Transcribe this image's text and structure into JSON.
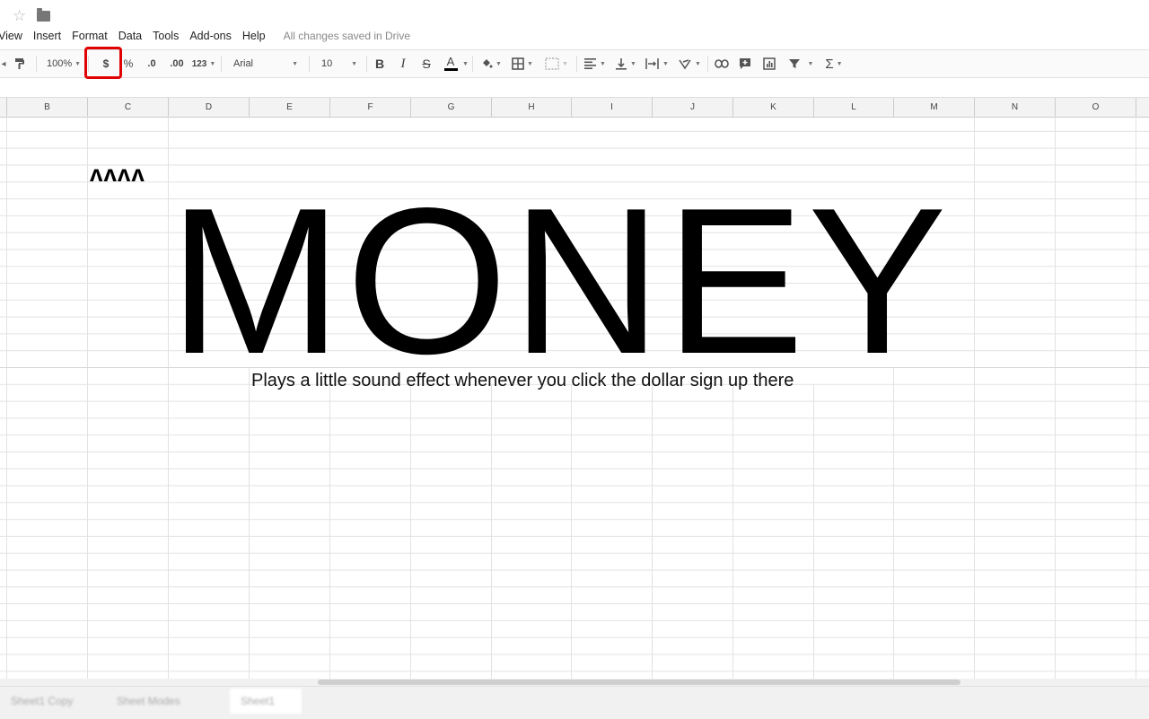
{
  "header": {
    "star_icon": "star-outline-icon",
    "folder_icon": "folder-icon"
  },
  "menu": {
    "items": [
      "View",
      "Insert",
      "Format",
      "Data",
      "Tools",
      "Add-ons",
      "Help"
    ],
    "save_status": "All changes saved in Drive"
  },
  "toolbar": {
    "zoom": "100%",
    "currency": "$",
    "percent": "%",
    "decrease_decimal": ".0",
    "increase_decimal": ".00",
    "more_formats": "123",
    "font": "Arial",
    "font_size": "10",
    "bold": "B",
    "italic": "I",
    "strikethrough": "S",
    "text_color": "A",
    "highlight_color": "#e00000"
  },
  "sheet": {
    "columns": [
      "B",
      "C",
      "D",
      "E",
      "F",
      "G",
      "H",
      "I",
      "J",
      "K",
      "L",
      "M",
      "N",
      "O"
    ],
    "c1_text": "ʌʌʌʌ",
    "d1_text": "MONEY",
    "e2_text": "Plays a little sound effect whenever you click the dollar sign up there"
  },
  "sheet_tabs": [
    "Sheet1 Copy",
    "Sheet Modes",
    "Sheet1"
  ]
}
